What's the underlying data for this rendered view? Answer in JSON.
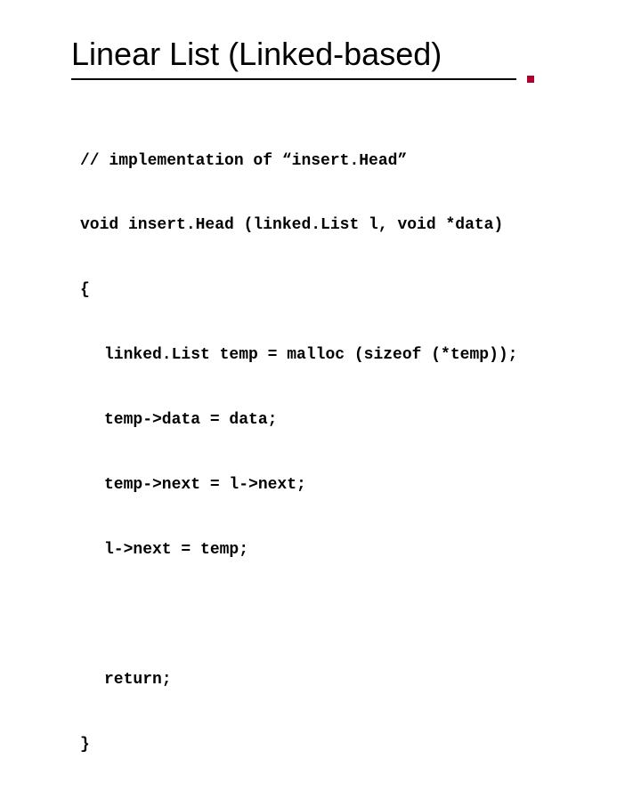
{
  "slide": {
    "title": "Linear List (Linked-based)",
    "code": {
      "l1": "// implementation of “insert.Head”",
      "l2": "void insert.Head (linked.List l, void *data)",
      "l3": "{",
      "l4": "linked.List temp = malloc (sizeof (*temp));",
      "l5": "temp->data = data;",
      "l6": "temp->next = l->next;",
      "l7": "l->next = temp;",
      "blank": " ",
      "l8": "return;",
      "l9": "}"
    }
  }
}
